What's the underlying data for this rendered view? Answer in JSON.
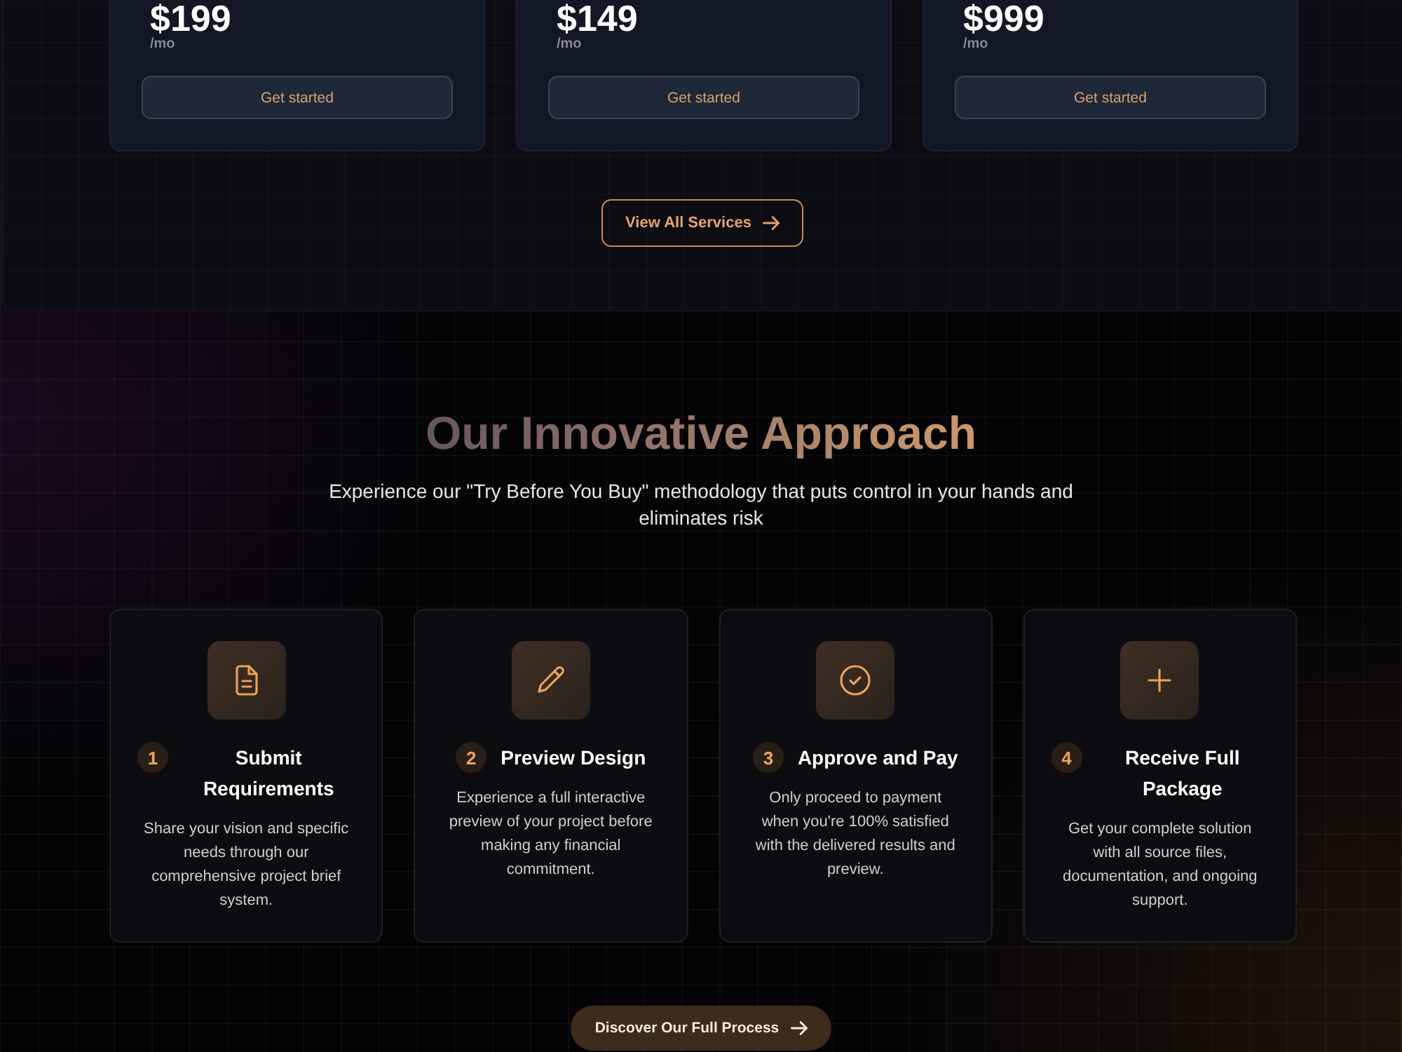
{
  "pricing": {
    "plans": [
      {
        "price": "$199",
        "period": "/mo",
        "button": "Get started"
      },
      {
        "price": "$149",
        "period": "/mo",
        "button": "Get started"
      },
      {
        "price": "$999",
        "period": "/mo",
        "button": "Get started"
      }
    ],
    "view_all_button": "View All Services"
  },
  "approach": {
    "title": "Our Innovative Approach",
    "subtitle": "Experience our \"Try Before You Buy\" methodology that puts control in your hands and eliminates risk",
    "steps": [
      {
        "number": "1",
        "title": "Submit Requirements",
        "description": "Share your vision and specific needs through our comprehensive project brief system."
      },
      {
        "number": "2",
        "title": "Preview Design",
        "description": "Experience a full interactive preview of your project before making any financial commitment."
      },
      {
        "number": "3",
        "title": "Approve and Pay",
        "description": "Only proceed to payment when you're 100% satisfied with the delivered results and preview."
      },
      {
        "number": "4",
        "title": "Receive Full Package",
        "description": "Get your complete solution with all source files, documentation, and ongoing support."
      }
    ],
    "cta_button": "Discover Our Full Process"
  }
}
